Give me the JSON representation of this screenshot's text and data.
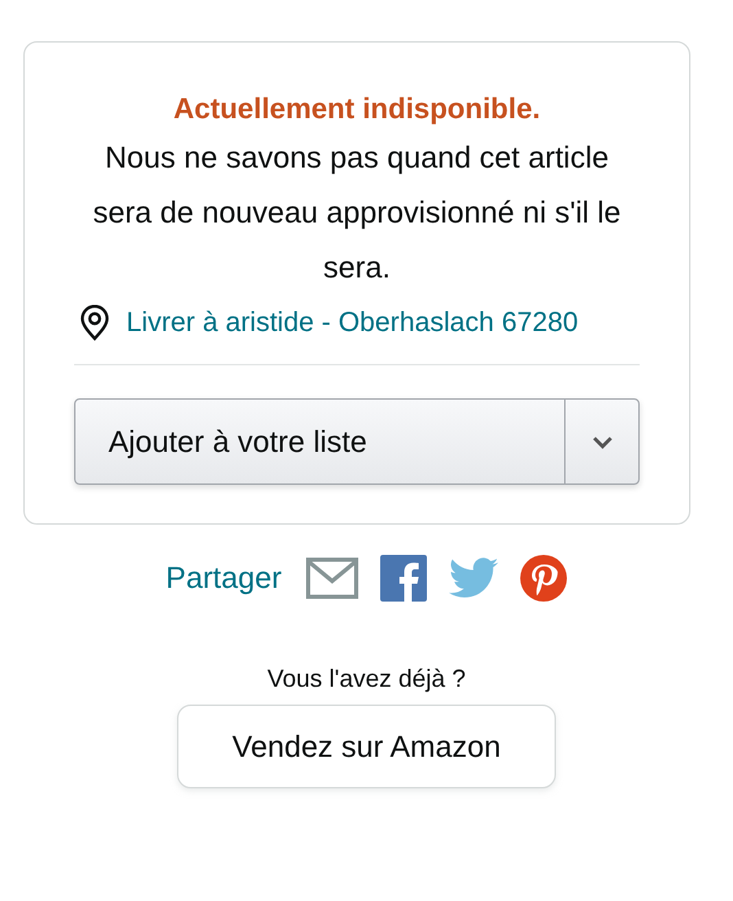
{
  "availability": {
    "status": "Actuellement indisponible.",
    "message": "Nous ne savons pas quand cet article sera de nouveau approvisionné ni s'il le sera."
  },
  "delivery": {
    "link": "Livrer à aristide - Oberhaslach 67280"
  },
  "list_button": {
    "label": "Ajouter à votre liste"
  },
  "share": {
    "label": "Partager",
    "icons": [
      {
        "kind": "mail"
      },
      {
        "kind": "facebook"
      },
      {
        "kind": "twitter"
      },
      {
        "kind": "pinterest"
      }
    ]
  },
  "sell": {
    "question": "Vous l'avez déjà ?",
    "button": "Vendez sur Amazon"
  }
}
